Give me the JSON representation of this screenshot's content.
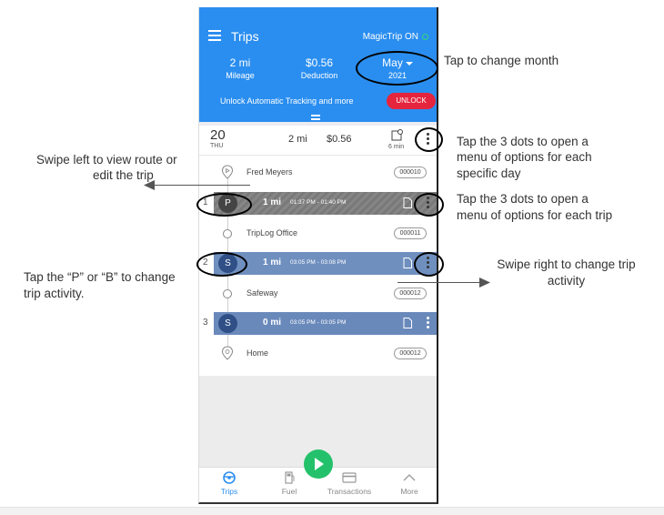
{
  "header": {
    "title": "Trips",
    "magictrip_label": "MagicTrip ON",
    "mileage_value": "2 mi",
    "mileage_label": "Mileage",
    "deduction_value": "$0.56",
    "deduction_label": "Deduction",
    "month_value": "May",
    "month_year": "2021",
    "unlock_text": "Unlock Automatic Tracking and more",
    "unlock_button": "UNLOCK",
    "colors": {
      "header_blue": "#2a8ef0",
      "unlock_red": "#e5243e"
    }
  },
  "day": {
    "date": "20",
    "weekday": "THU",
    "distance": "2 mi",
    "deduction": "$0.56",
    "duration": "6 min"
  },
  "stops": [
    {
      "name": "Fred Meyers",
      "code": "000010"
    },
    {
      "name": "TripLog Office",
      "code": "000011"
    },
    {
      "name": "Safeway",
      "code": "000012"
    },
    {
      "name": "Home",
      "code": "000012"
    }
  ],
  "trips": [
    {
      "number": "1",
      "activity": "P",
      "distance": "1 mi",
      "time": "01:37 PM - 01:40 PM"
    },
    {
      "number": "2",
      "activity": "S",
      "distance": "1 mi",
      "time": "03:05 PM - 03:08 PM"
    },
    {
      "number": "3",
      "activity": "S",
      "distance": "0 mi",
      "time": "03:05 PM - 03:05 PM"
    }
  ],
  "nav": {
    "items": [
      {
        "label": "Trips",
        "icon": "steering-wheel-icon"
      },
      {
        "label": "Fuel",
        "icon": "fuel-pump-icon"
      },
      {
        "label": "Transactions",
        "icon": "card-icon"
      },
      {
        "label": "More",
        "icon": "chevron-up-icon"
      }
    ]
  },
  "annotations": {
    "change_month": "Tap to change month",
    "day_menu_1": "Tap the 3 dots to open a",
    "day_menu_2": "menu of options for each",
    "day_menu_3": "specific day",
    "trip_menu_1": "Tap the 3 dots to open a",
    "trip_menu_2": "menu of options for each trip",
    "swipe_left_1": "Swipe left to view route or",
    "swipe_left_2": "edit the trip",
    "activity_1": "Tap the “P” or “B” to change",
    "activity_2": "trip activity.",
    "swipe_right_1": "Swipe right to change trip",
    "swipe_right_2": "activity"
  }
}
